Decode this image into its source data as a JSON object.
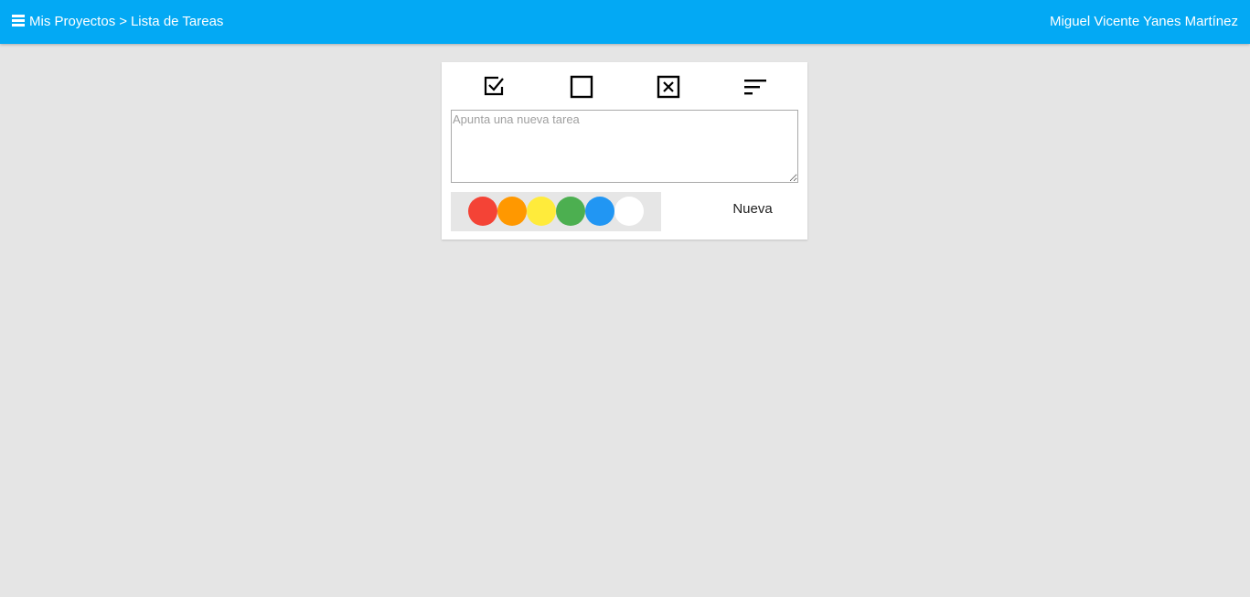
{
  "header": {
    "breadcrumb": {
      "projects": "Mis Proyectos",
      "separator": ">",
      "current": "Lista de Tareas"
    },
    "user_name": "Miguel Vicente Yanes Martínez",
    "background_color": "#03a9f4"
  },
  "toolbar": {
    "icons": [
      "check-box-icon",
      "empty-box-icon",
      "x-box-icon",
      "sort-icon"
    ]
  },
  "task_input": {
    "placeholder": "Apunta una nueva tarea",
    "value": ""
  },
  "colors": [
    "#f44336",
    "#ff9800",
    "#ffeb3b",
    "#4caf50",
    "#2196f3",
    "#ffffff"
  ],
  "new_button_label": "Nueva"
}
